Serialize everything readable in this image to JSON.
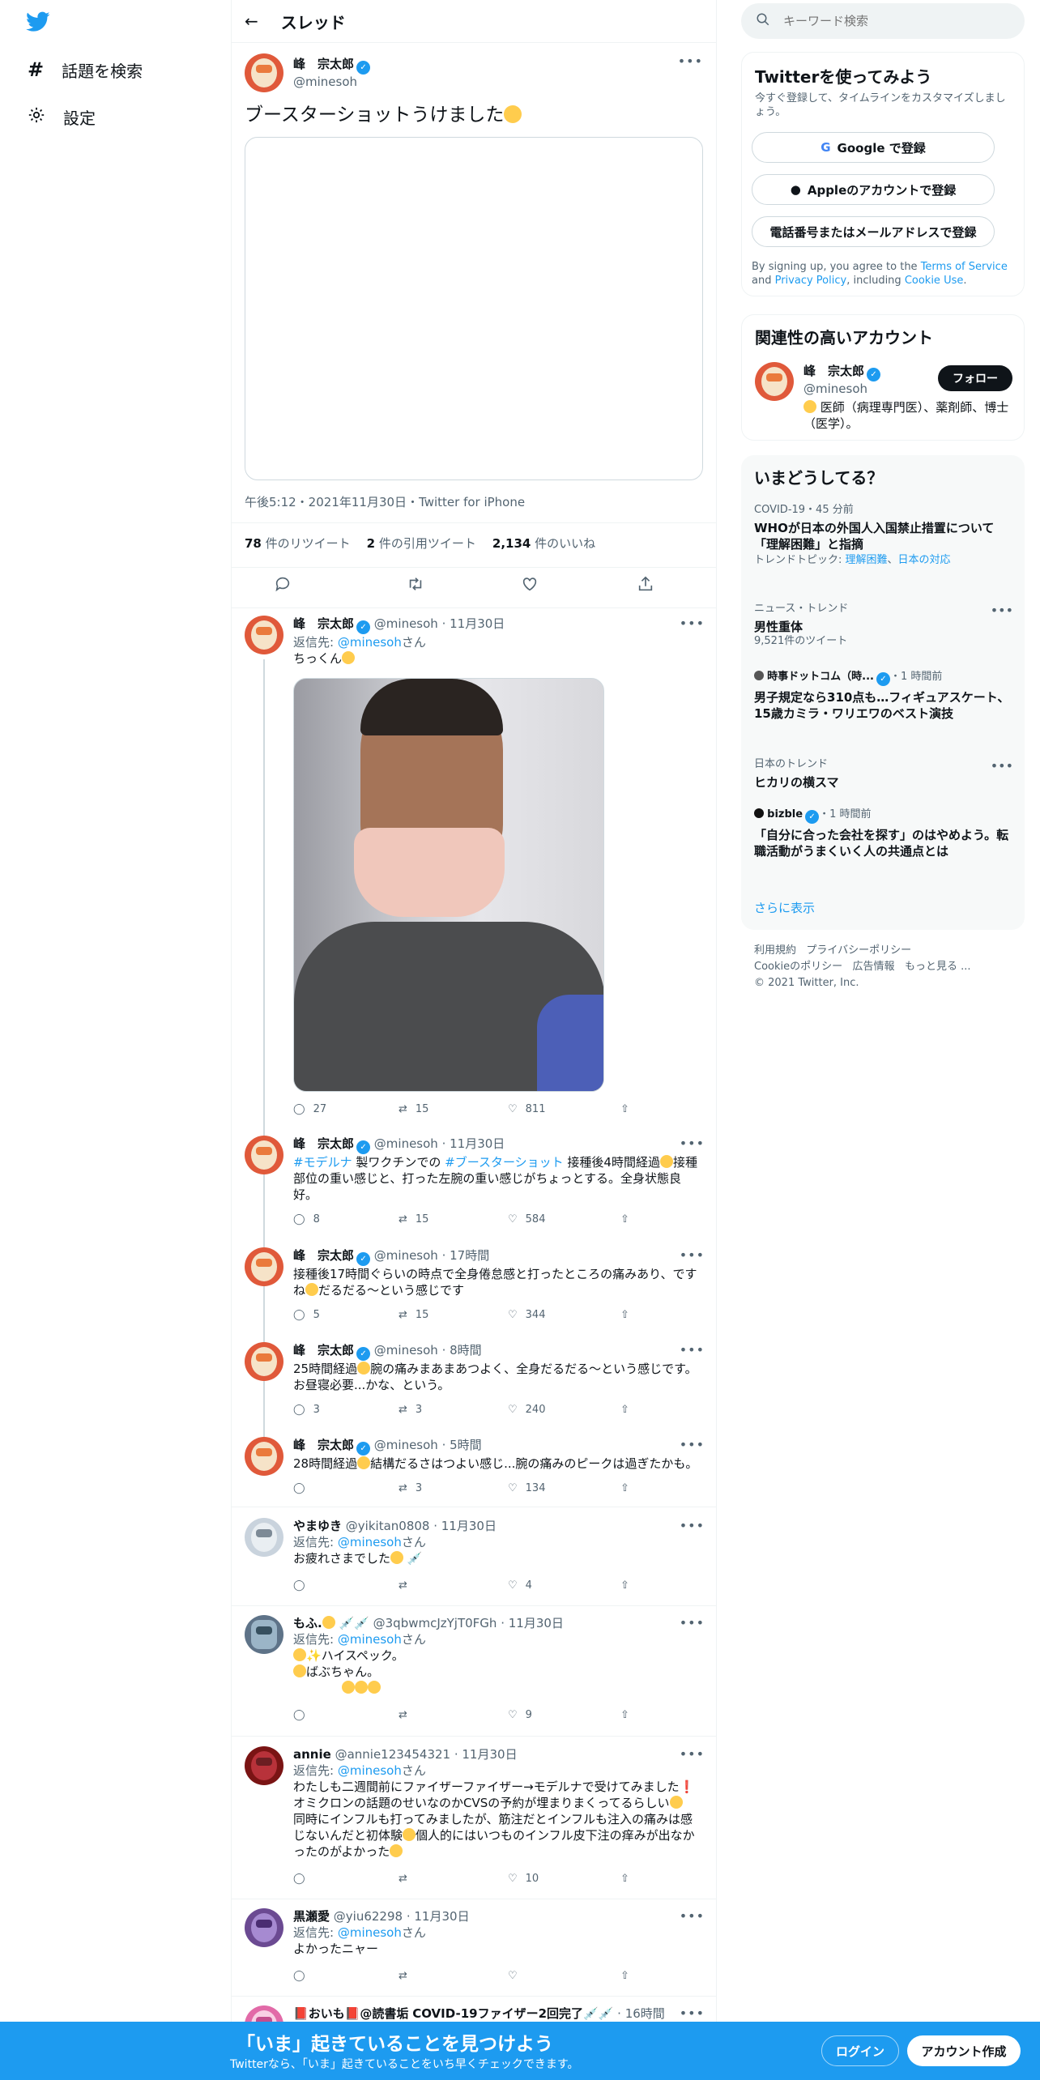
{
  "sidebar": {
    "explore": "話題を検索",
    "settings": "設定"
  },
  "header": {
    "title": "スレッド"
  },
  "main_tweet": {
    "name": "峰　宗太郎",
    "handle": "@minesoh",
    "text": "ブースターショットうけました",
    "time": "午後5:12・2021年11月30日・Twitter for iPhone",
    "retweets": "78",
    "retweets_label": "件のリツイート",
    "quotes": "2",
    "quotes_label": "件の引用ツイート",
    "likes": "2,134",
    "likes_label": "件のいいね"
  },
  "tweets": [
    {
      "name": "峰　宗太郎",
      "handle": "@minesoh",
      "time": "11月30日",
      "reply_prefix": "返信先: ",
      "reply_to": "@minesoh",
      "reply_suffix": "さん",
      "text": "ちっくん",
      "replies": "27",
      "retweets": "15",
      "likes": "811"
    },
    {
      "name": "峰　宗太郎",
      "handle": "@minesoh",
      "time": "11月30日",
      "tag1": "#モデルナ",
      "text_a": " 製ワクチンでの ",
      "tag2": "#ブースターショット",
      "text_b": " 接種後4時間経過",
      "text_c": "接種部位の重い感じと、打った左腕の重い感じがちょっとする。全身状態良好。",
      "replies": "8",
      "retweets": "15",
      "likes": "584"
    },
    {
      "name": "峰　宗太郎",
      "handle": "@minesoh",
      "time": "17時間",
      "text_a": "接種後17時間ぐらいの時点で全身倦怠感と打ったところの痛みあり、ですね",
      "text_b": "だるだる〜という感じです",
      "replies": "5",
      "retweets": "15",
      "likes": "344"
    },
    {
      "name": "峰　宗太郎",
      "handle": "@minesoh",
      "time": "8時間",
      "text_a": "25時間経過",
      "text_b": "腕の痛みまあまあつよく、全身だるだる〜という感じです。お昼寝必要...かな、という。",
      "replies": "3",
      "retweets": "3",
      "likes": "240"
    },
    {
      "name": "峰　宗太郎",
      "handle": "@minesoh",
      "time": "5時間",
      "text_a": "28時間経過",
      "text_b": "結構だるさはつよい感じ...腕の痛みのピークは過ぎたかも。",
      "replies": "",
      "retweets": "3",
      "likes": "134"
    },
    {
      "name": "やまゆき",
      "handle": "@yikitan0808",
      "time": "11月30日",
      "reply_prefix": "返信先: ",
      "reply_to": "@minesoh",
      "reply_suffix": "さん",
      "text": "お疲れさまでした",
      "replies": "",
      "retweets": "",
      "likes": "4"
    },
    {
      "name": "もふ.",
      "handle": "@3qbwmcJzYjT0FGh",
      "time": "11月30日",
      "reply_prefix": "返信先: ",
      "reply_to": "@minesoh",
      "reply_suffix": "さん",
      "line1": "ハイスペック。",
      "line2": "ばぶちゃん。",
      "replies": "",
      "retweets": "",
      "likes": "9"
    },
    {
      "name": "annie",
      "handle": "@annie123454321",
      "time": "11月30日",
      "reply_prefix": "返信先: ",
      "reply_to": "@minesoh",
      "reply_suffix": "さん",
      "text": "わたしも二週間前にファイザーファイザー→モデルナで受けてみました",
      "text2": "オミクロンの話題のせいなのかCVSの予約が埋まりまくってるらしい",
      "text3": "同時にインフルも打ってみましたが、筋注だとインフルも注入の痛みは感じないんだと初体験",
      "text4": "個人的にはいつものインフル皮下注の痒みが出なかったのがよかった",
      "replies": "",
      "retweets": "",
      "likes": "10"
    },
    {
      "name": "黒瀬愛",
      "handle": "@yiu62298",
      "time": "11月30日",
      "reply_prefix": "返信先: ",
      "reply_to": "@minesoh",
      "reply_suffix": "さん",
      "text": "よかったニャー",
      "replies": "",
      "retweets": "",
      "likes": ""
    },
    {
      "name": "おいも",
      "name2": "@読書垢",
      "name3": "COVID-19ファイザー2回完了",
      "time": "16時間"
    }
  ],
  "search": {
    "placeholder": "キーワード検索"
  },
  "signup": {
    "title": "Twitterを使ってみよう",
    "subtitle": "今すぐ登録して、タイムラインをカスタマイズしましょう。",
    "google": "Google で登録",
    "apple": "Appleのアカウントで登録",
    "phone": "電話番号またはメールアドレスで登録",
    "terms_a": "By signing up, you agree to the ",
    "terms_link": "Terms of Service",
    "terms_b": " and ",
    "privacy_link": "Privacy Policy",
    "terms_c": ", including ",
    "cookie_link": "Cookie Use",
    "terms_d": "."
  },
  "related": {
    "title": "関連性の高いアカウント",
    "name": "峰　宗太郎",
    "handle": "@minesoh",
    "follow": "フォロー",
    "bio": "医師（病理専門医）、薬剤師、博士（医学）。"
  },
  "trends": {
    "title": "いまどうしてる？",
    "items": [
      {
        "meta": "COVID-19・45 分前",
        "name": "WHOが日本の外国人入国禁止措置について「理解困難」と指摘",
        "topic_label": "トレンドトピック: ",
        "topic_a": "理解困難",
        "topic_b": "日本の対応"
      },
      {
        "meta": "ニュース・トレンド",
        "name": "男性重体",
        "sub": "9,521件のツイート"
      },
      {
        "source": "時事ドットコム（時...",
        "meta": "・1 時間前",
        "name": "男子規定なら310点も…フィギュアスケート、15歳カミラ・ワリエワのベスト演技"
      },
      {
        "meta": "日本のトレンド",
        "name": "ヒカリの横スマ"
      },
      {
        "source": "bizble",
        "meta": "・1 時間前",
        "name": "「自分に合った会社を探す」のはやめよう。転職活動がうまくいく人の共通点とは"
      }
    ],
    "show_more": "さらに表示"
  },
  "footer_links": {
    "terms": "利用規約",
    "privacy": "プライバシーポリシー",
    "cookie": "Cookieのポリシー",
    "ads": "広告情報",
    "more": "もっと見る ...",
    "copyright": "© 2021 Twitter, Inc."
  },
  "banner": {
    "title": "「いま」起きていることを見つけよう",
    "subtitle": "Twitterなら、「いま」起きていることをいち早くチェックできます。",
    "login": "ログイン",
    "signup": "アカウント作成"
  },
  "colors": {
    "accent": "#1d9bf0",
    "text": "#0f1419",
    "muted": "#536471"
  }
}
